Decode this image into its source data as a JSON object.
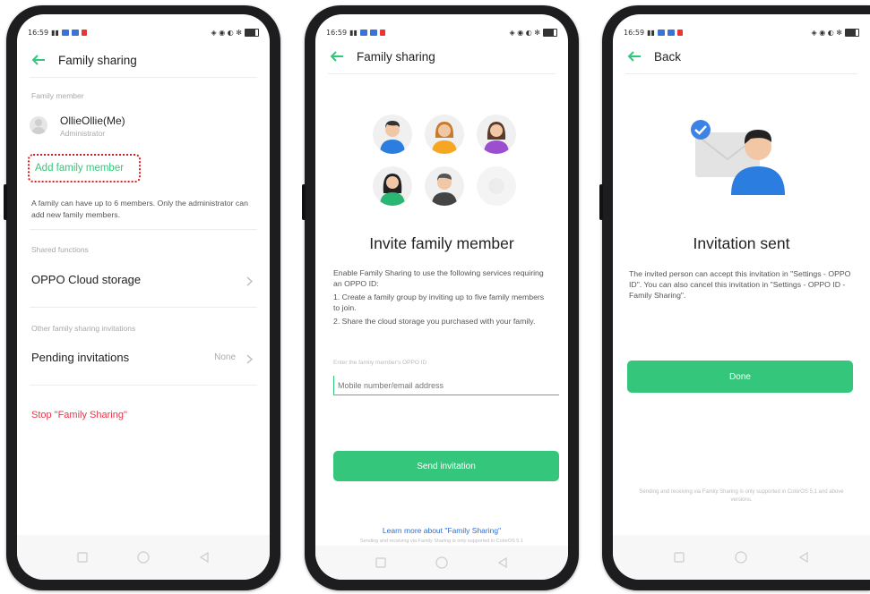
{
  "colors": {
    "accent": "#34c77b",
    "danger": "#e0394a",
    "highlight_border": "#e02020"
  },
  "status": {
    "time": "16:59"
  },
  "screen1": {
    "title": "Family sharing",
    "family_member_label": "Family member",
    "member_name": "OllieOllie(Me)",
    "member_role": "Administrator",
    "add_member": "Add family member",
    "info": "A family can have up to 6 members. Only the administrator can add new family members.",
    "shared_functions_label": "Shared functions",
    "cloud_storage": "OPPO Cloud storage",
    "other_label": "Other family sharing invitations",
    "pending": "Pending invitations",
    "pending_value": "None",
    "stop": "Stop \"Family Sharing\""
  },
  "screen2": {
    "title": "Family sharing",
    "heading": "Invite family member",
    "desc1": "Enable Family Sharing to use the following services requiring an OPPO ID:",
    "desc2": "1. Create a family group by inviting up to five family members to join.",
    "desc3": "2. Share the cloud storage you purchased with your family.",
    "input_label": "Enter the family member's OPPO ID",
    "input_placeholder": "Mobile number/email address",
    "send_button": "Send invitation",
    "learn_more": "Learn more about \"Family Sharing\"",
    "footnote": "Sending and receiving via Family Sharing is only supported in ColorOS 5.1"
  },
  "screen3": {
    "back": "Back",
    "heading": "Invitation sent",
    "desc": "The invited person can accept this invitation in \"Settings - OPPO ID\". You can also cancel this invitation in \"Settings - OPPO ID - Family Sharing\".",
    "done_button": "Done",
    "footnote": "Sending and receiving via Family Sharing is only supported in ColorOS 5.1 and above versions."
  }
}
